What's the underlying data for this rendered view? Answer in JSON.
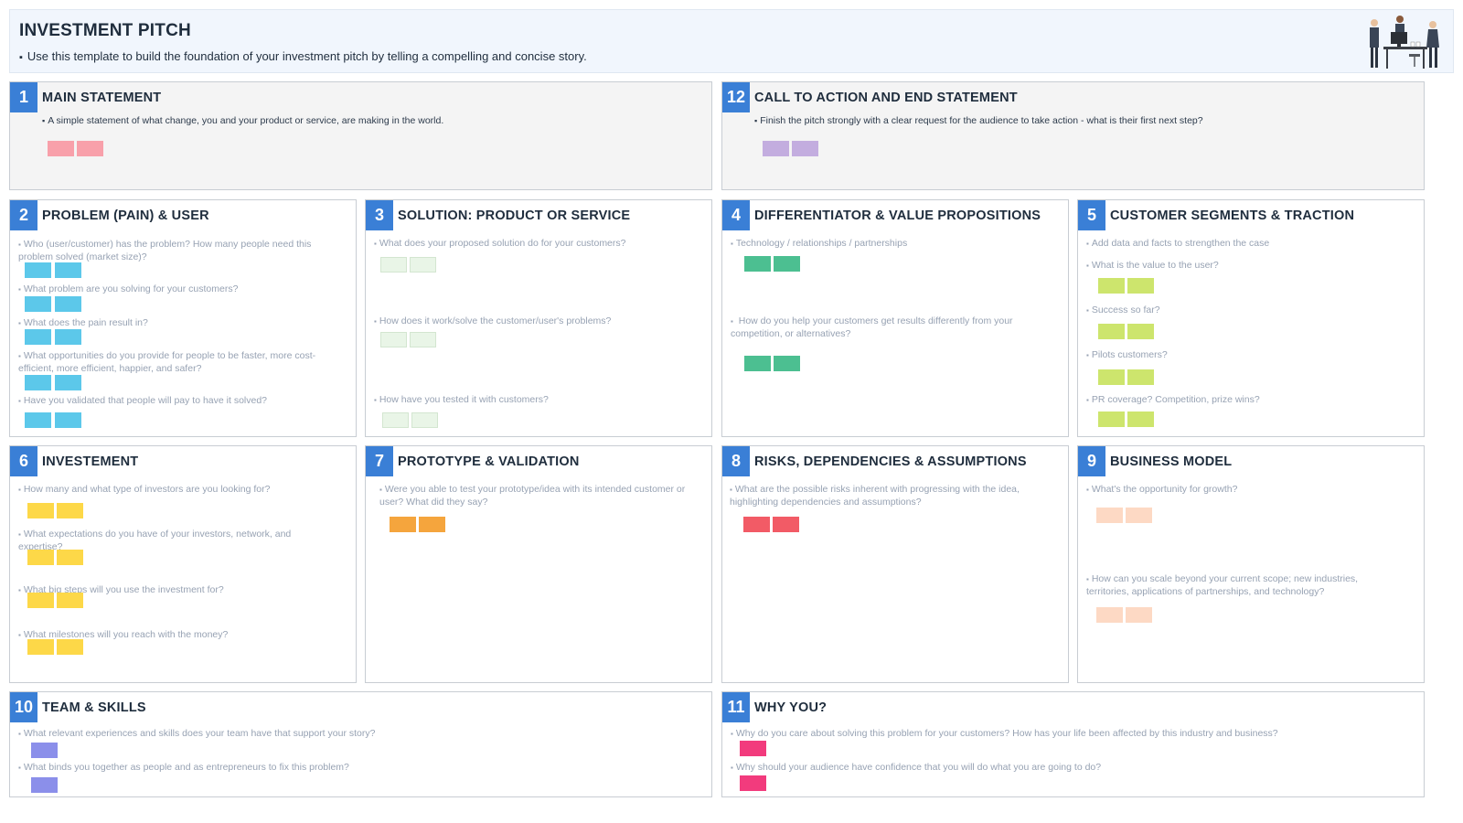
{
  "header": {
    "title": "INVESTMENT PITCH",
    "subtitle": "Use this template to build the foundation of your investment pitch by telling a compelling and concise story."
  },
  "colors": {
    "accent": "#3a7fd6",
    "pink": "#f8a0aa",
    "purple": "#c3addf",
    "cyan": "#5cc8ea",
    "mint": "#e9f5e7",
    "green": "#4cbf91",
    "lime": "#cde56d",
    "yellow": "#fdd848",
    "orange": "#f5a53d",
    "red": "#f25b66",
    "peach": "#fdd9c4",
    "periwinkle": "#8b8fea",
    "magenta": "#f23b7d"
  },
  "panels": {
    "p1": {
      "num": "1",
      "title": "MAIN STATEMENT",
      "q1": "A simple statement of what change, you and your product or service, are making in the world."
    },
    "p12": {
      "num": "12",
      "title": "CALL TO ACTION AND END STATEMENT",
      "q1": "Finish the pitch strongly with a clear request for the audience to take action - what is their first next step?"
    },
    "p2": {
      "num": "2",
      "title": "PROBLEM (PAIN) & USER",
      "q1": "Who (user/customer) has the problem? How many people need this problem solved (market size)?",
      "q2": "What problem are you solving for your customers?",
      "q3": "What does the pain result in?",
      "q4": "What opportunities do you provide for people to be faster, more cost-efficient, more efficient, happier, and safer?",
      "q5": "Have you validated that people will pay to have it solved?"
    },
    "p3": {
      "num": "3",
      "title": "SOLUTION: PRODUCT OR SERVICE",
      "q1": "What does your proposed solution do for your customers?",
      "q2": "How does it work/solve the customer/user's problems?",
      "q3": "How have you tested it with customers?"
    },
    "p4": {
      "num": "4",
      "title": "DIFFERENTIATOR & VALUE PROPOSITIONS",
      "q1": "Technology / relationships / partnerships",
      "q2": " How do you help your customers get results differently from your competition, or alternatives?"
    },
    "p5": {
      "num": "5",
      "title": "CUSTOMER SEGMENTS & TRACTION",
      "q1": "Add data and facts to strengthen the case",
      "q2": "What is the value to the user?",
      "q3": "Success so far?",
      "q4": "Pilots customers?",
      "q5": "PR coverage? Competition, prize wins?"
    },
    "p6": {
      "num": "6",
      "title": "INVESTEMENT",
      "q1": "How many and what type of investors are you looking for?",
      "q2": "What expectations do you have of your investors, network, and expertise?",
      "q3": "What big steps will you use the investment for?",
      "q4": "What milestones will you reach with the money?"
    },
    "p7": {
      "num": "7",
      "title": "PROTOTYPE & VALIDATION",
      "q1": "Were you able to test your prototype/idea with its intended customer or user? What did they say?"
    },
    "p8": {
      "num": "8",
      "title": "RISKS, DEPENDENCIES & ASSUMPTIONS",
      "q1": "What are the possible risks inherent with progressing with the idea, highlighting dependencies and assumptions?"
    },
    "p9": {
      "num": "9",
      "title": "BUSINESS MODEL",
      "q1": "What's the opportunity for growth?",
      "q2": "How can you scale beyond your current scope; new industries, territories, applications of partnerships, and technology?"
    },
    "p10": {
      "num": "10",
      "title": "TEAM & SKILLS",
      "q1": "What relevant experiences and skills does your team have that support your story?",
      "q2": "What binds you together as people and as entrepreneurs to fix this problem?"
    },
    "p11": {
      "num": "11",
      "title": "WHY YOU?",
      "q1": "Why do you care about solving this problem for your customers? How has your life been affected by this industry and business?",
      "q2": "Why should your audience have confidence that you will do what you are going to do?"
    }
  }
}
